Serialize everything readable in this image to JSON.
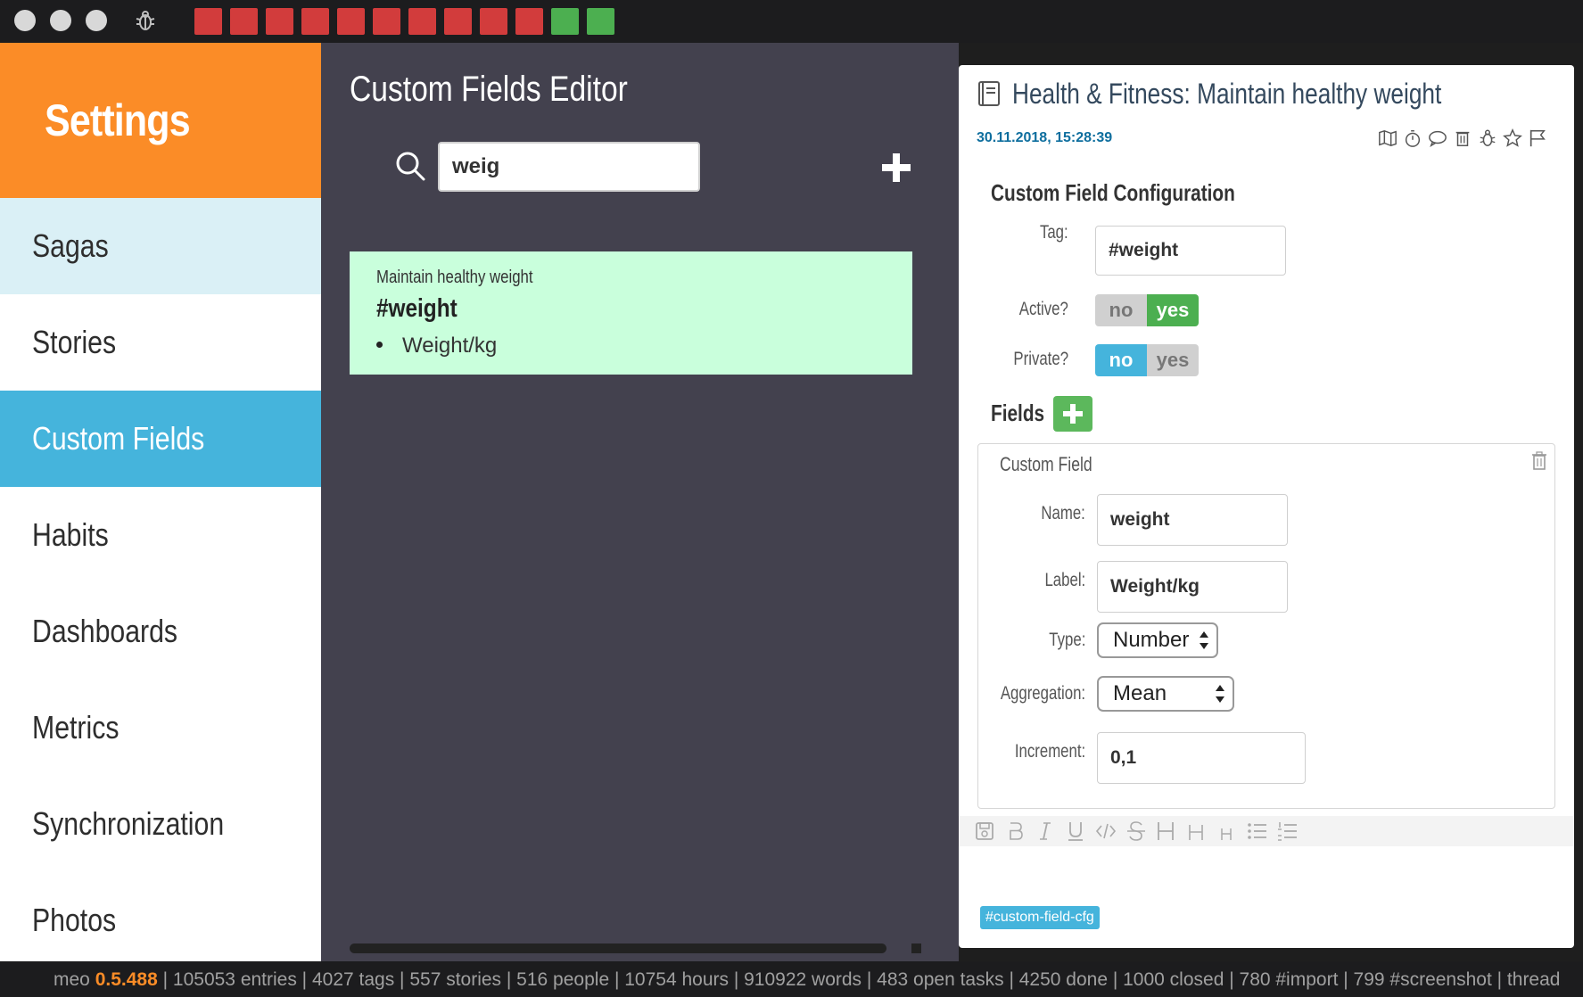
{
  "top_bar": {
    "squares": [
      "red",
      "red",
      "red",
      "red",
      "red",
      "red",
      "red",
      "red",
      "red",
      "red",
      "green",
      "green"
    ],
    "colors": {
      "red": "#d23c3c",
      "green": "#4caf50"
    }
  },
  "sidebar": {
    "title": "Settings",
    "items": [
      {
        "label": "Sagas"
      },
      {
        "label": "Stories"
      },
      {
        "label": "Custom Fields",
        "active": true
      },
      {
        "label": "Habits"
      },
      {
        "label": "Dashboards"
      },
      {
        "label": "Metrics"
      },
      {
        "label": "Synchronization"
      },
      {
        "label": "Photos"
      }
    ],
    "accent": "#fb8c27",
    "active_color": "#45b4dc"
  },
  "editor": {
    "title": "Custom Fields Editor",
    "search_value": "weig",
    "result": {
      "title": "Maintain healthy weight",
      "tag": "#weight",
      "fields": [
        "Weight/kg"
      ]
    }
  },
  "entry": {
    "title": "Health & Fitness: Maintain healthy weight",
    "timestamp": "30.11.2018, 15:28:39",
    "actions": [
      "map-icon",
      "timer-icon",
      "comment-icon",
      "trash-icon",
      "bug-icon",
      "star-icon",
      "flag-icon"
    ],
    "config": {
      "heading": "Custom Field Configuration",
      "tag_label": "Tag:",
      "tag_value": "#weight",
      "active_label": "Active?",
      "active": "yes",
      "private_label": "Private?",
      "private": "no",
      "no_label": "no",
      "yes_label": "yes"
    },
    "fields_heading": "Fields",
    "custom_field": {
      "title": "Custom Field",
      "name_label": "Name:",
      "name_value": "weight",
      "label_label": "Label:",
      "label_value": "Weight/kg",
      "type_label": "Type:",
      "type_value": "Number",
      "aggregation_label": "Aggregation:",
      "aggregation_value": "Mean",
      "increment_label": "Increment:",
      "increment_value": "0,1"
    },
    "toolbar": [
      "save-icon",
      "bold-icon",
      "italic-icon",
      "underline-icon",
      "code-icon",
      "strikethrough-icon",
      "heading1-icon",
      "heading2-icon",
      "heading3-icon",
      "bullet-list-icon",
      "numbered-list-icon"
    ],
    "hashtag": "#custom-field-cfg"
  },
  "footer": {
    "app_prefix": "meo",
    "version": "0.5.488",
    "stats": " | 105053 entries | 4027 tags | 557 stories | 516 people | 10754 hours | 910922 words | 483 open tasks | 4250 done | 1000 closed | 780 #import | 799 #screenshot | thread"
  }
}
